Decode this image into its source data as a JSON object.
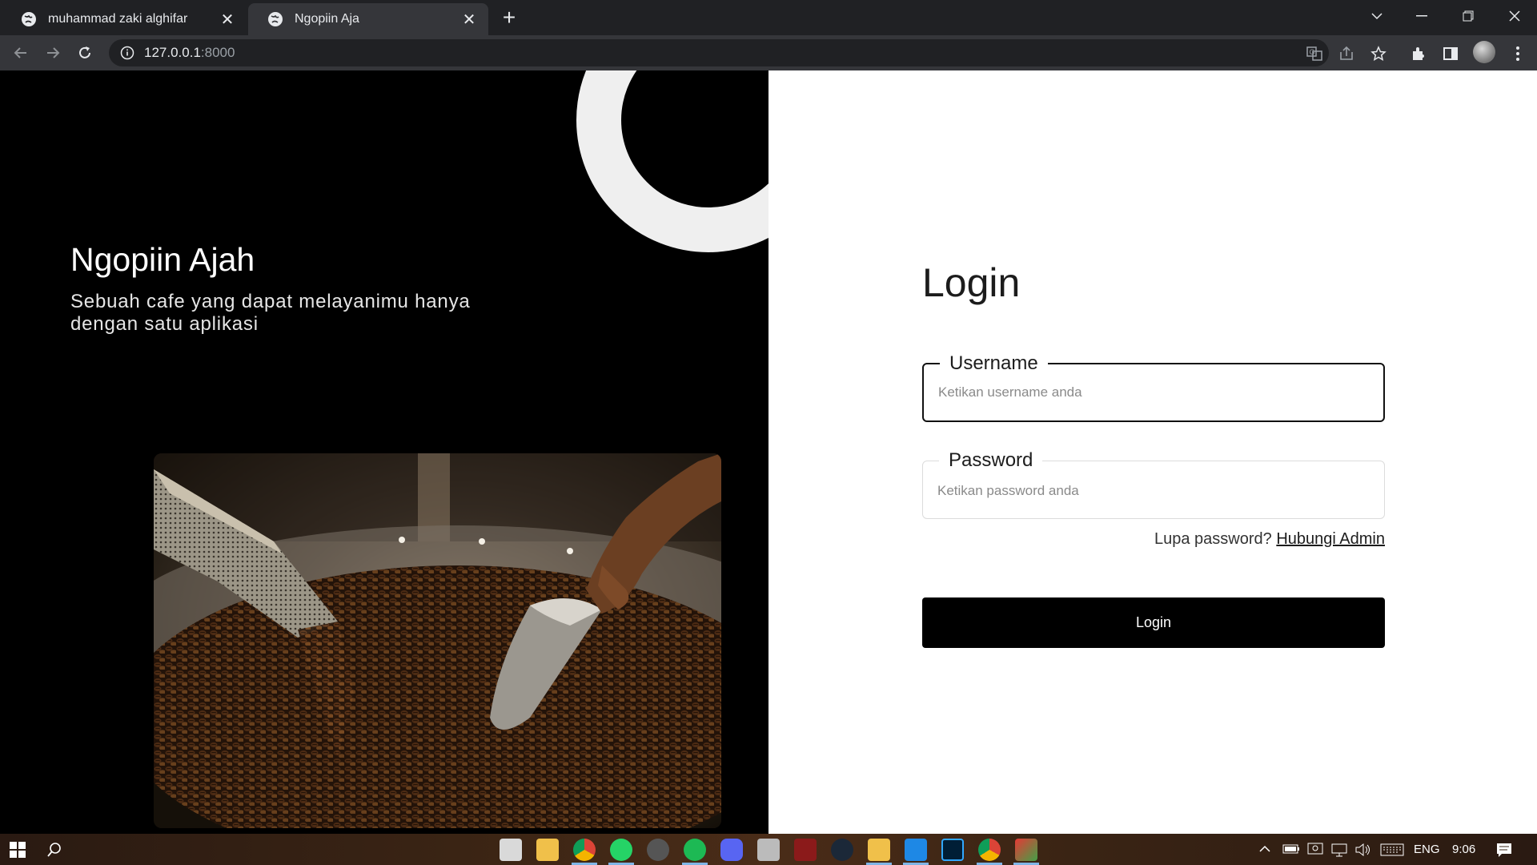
{
  "browser": {
    "tabs": [
      {
        "title": "muhammad zaki alghifar"
      },
      {
        "title": "Ngopiin Aja"
      }
    ],
    "new_tab_label": "+",
    "close_glyph": "✕",
    "url_host": "127.0.0.1",
    "url_port": ":8000"
  },
  "hero": {
    "title": "Ngopiin Ajah",
    "subtitle": "Sebuah cafe yang dapat melayanimu hanya dengan satu aplikasi"
  },
  "login": {
    "heading": "Login",
    "username_label": "Username",
    "username_placeholder": "Ketikan username anda",
    "password_label": "Password",
    "password_placeholder": "Ketikan password anda",
    "forgot_text": "Lupa password?",
    "forgot_link": "Hubungi Admin",
    "submit_label": "Login"
  },
  "taskbar": {
    "language": "ENG",
    "time": "9:06"
  },
  "colors": {
    "chrome_dark": "#202124",
    "chrome_tab": "#35363a",
    "hero_bg": "#000000",
    "ring": "#efefef",
    "button_bg": "#000000"
  }
}
